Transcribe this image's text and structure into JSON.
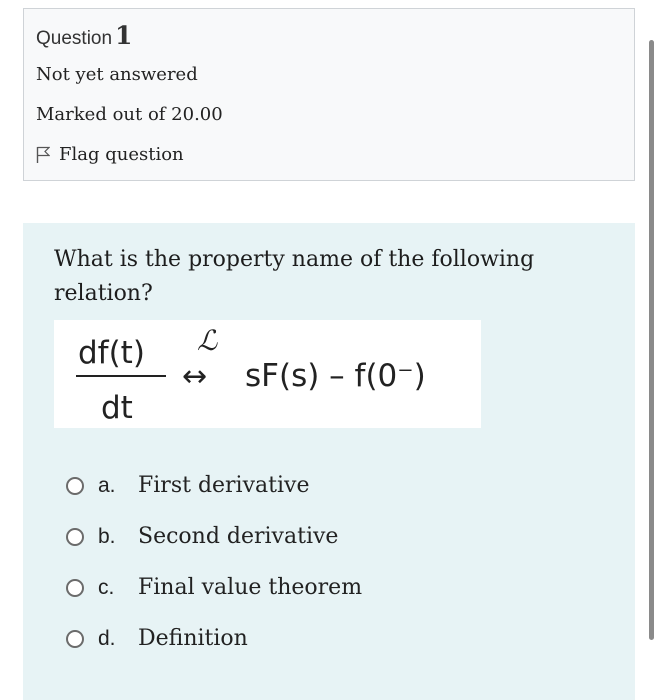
{
  "question_info": {
    "label": "Question",
    "number": "1",
    "state": "Not yet answered",
    "marks": "Marked out of 20.00",
    "flag_label": "Flag question"
  },
  "question_text": "What is the property name of the following relation?",
  "formula": {
    "numerator": "df(t)",
    "denominator": "dt",
    "transform_symbol": "ℒ",
    "arrow": "↔",
    "rhs": "sF(s) – f(0⁻)"
  },
  "options": [
    {
      "letter": "a.",
      "label": "First derivative"
    },
    {
      "letter": "b.",
      "label": "Second derivative"
    },
    {
      "letter": "c.",
      "label": "Final value theorem"
    },
    {
      "letter": "d.",
      "label": "Definition"
    }
  ],
  "colors": {
    "info_bg": "#f8f9fa",
    "content_bg": "#e7f3f5",
    "border": "#cfd3d7"
  }
}
